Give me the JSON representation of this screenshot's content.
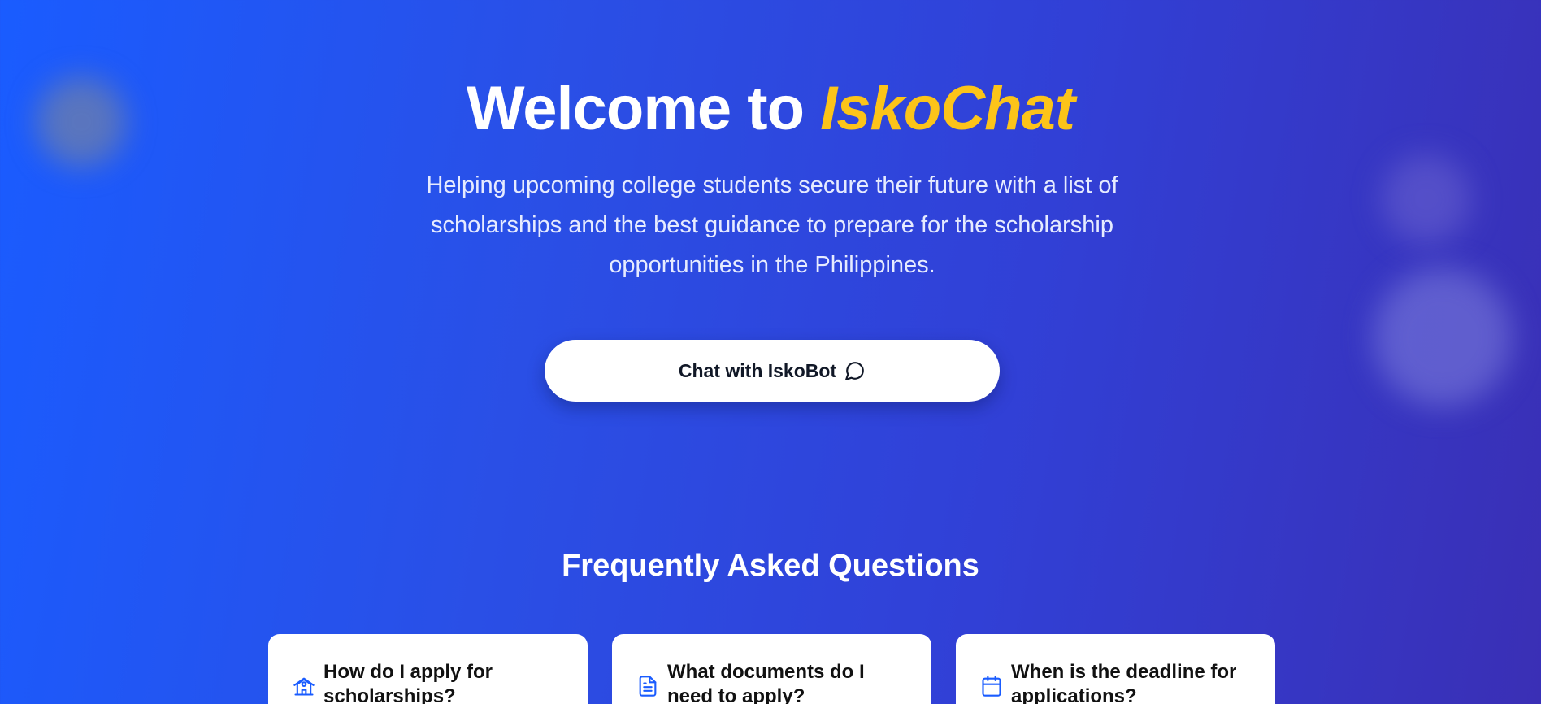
{
  "hero": {
    "title_prefix": "Welcome to ",
    "title_brand": "IskoChat",
    "subtitle": "Helping upcoming college students secure their future with a list of scholarships and the best guidance to prepare for the scholarship opportunities in the Philippines.",
    "cta_label": "Chat with IskoBot",
    "cta_icon": "chat-bubble-icon"
  },
  "faq": {
    "heading": "Frequently Asked Questions",
    "items": [
      {
        "question": "How do I apply for scholarships?",
        "icon": "school-icon"
      },
      {
        "question": "What documents do I need to apply?",
        "icon": "document-icon"
      },
      {
        "question": "When is the deadline for applications?",
        "icon": "calendar-icon"
      }
    ]
  },
  "colors": {
    "background_start": "#1a5cff",
    "background_end": "#3a2fb5",
    "brand_accent": "#fcc419",
    "icon_accent": "#1a5cff",
    "card_background": "#ffffff"
  }
}
